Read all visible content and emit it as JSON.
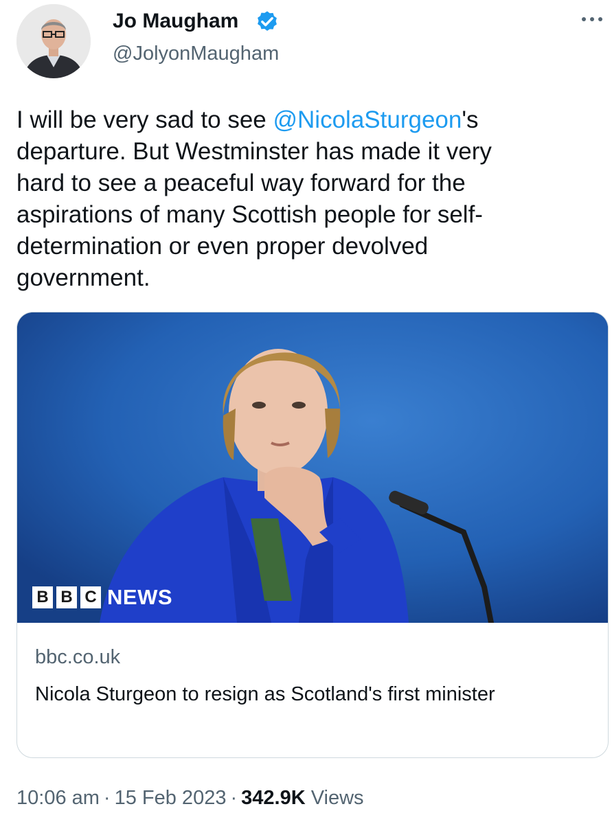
{
  "author": {
    "name": "Jo Maugham",
    "handle": "@JolyonMaugham",
    "verified": true
  },
  "tweet": {
    "text_before": "I will be very sad to see ",
    "mention": "@NicolaSturgeon",
    "text_after": "'s\ndeparture. But Westminster has made it very\nhard to see a peaceful way forward for the\naspirations of many Scottish people for self-\ndetermination or even proper devolved\ngovernment."
  },
  "card": {
    "logo_letters": [
      "B",
      "B",
      "C"
    ],
    "logo_word": "NEWS",
    "domain": "bbc.co.uk",
    "title": "Nicola Sturgeon to resign as Scotland's first minister"
  },
  "meta": {
    "time": "10:06 am",
    "date": "15 Feb 2023",
    "views_count": "342.9K",
    "views_label": "Views"
  },
  "colors": {
    "accent": "#1d9bf0",
    "text": "#0f1419",
    "secondary": "#536471",
    "card_image_blue": "#2b6bbf"
  },
  "icons": {
    "verified": "verified-badge-icon",
    "more": "more-options-icon"
  }
}
